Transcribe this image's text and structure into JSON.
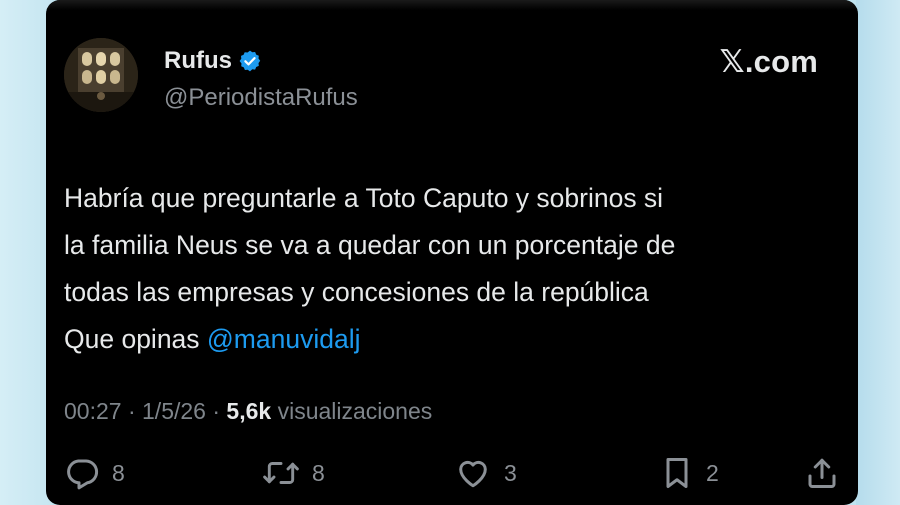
{
  "author": {
    "name": "Rufus",
    "handle": "@PeriodistaRufus",
    "verified": true
  },
  "brand": "𝕏.com",
  "tweet": {
    "lines": [
      "Habría que preguntarle a Toto Caputo y sobrinos si",
      "la familia Neus se va a quedar con un porcentaje de",
      "todas las empresas y concesiones de la república",
      "Que opinas "
    ],
    "mention": "@manuvidalj"
  },
  "meta": {
    "time": "00:27",
    "separator1": " · ",
    "date": "1/5/26",
    "separator2": " · ",
    "views_count": "5,6k",
    "views_label": " visualizaciones"
  },
  "actions": {
    "replies": "8",
    "retweets": "8",
    "likes": "3",
    "bookmarks": "2"
  },
  "colors": {
    "background": "#000000",
    "text": "#e7e9ea",
    "muted": "#8b9096",
    "mention": "#1d9bf0",
    "verified_badge": "#1d9bf0"
  },
  "icons": {
    "verified": "verified-badge-icon",
    "reply": "reply-icon",
    "retweet": "retweet-icon",
    "like": "heart-icon",
    "bookmark": "bookmark-icon",
    "share": "share-icon"
  }
}
